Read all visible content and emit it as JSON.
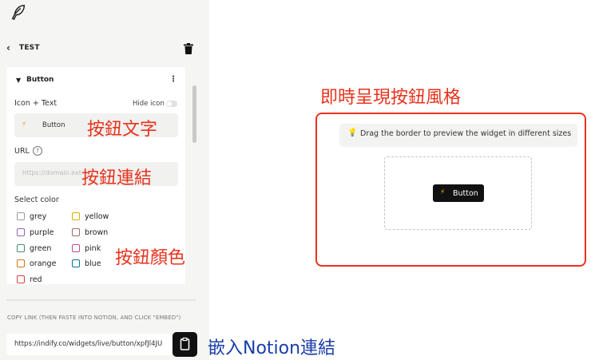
{
  "header": {
    "back_icon": "chevron-left-icon",
    "title": "TEST",
    "delete_icon": "trash-icon",
    "logo_icon": "feather-icon"
  },
  "widget": {
    "name": "Button",
    "section_icon": "caret-down-icon",
    "menu_icon": "kebab-icon",
    "icon_text_label": "Icon + Text",
    "hide_icon_label": "Hide icon",
    "hide_icon_on": false,
    "icon_glyph": "⚡",
    "text_value": "Button",
    "url_label": "URL",
    "url_help": "?",
    "url_placeholder": "https://domain.ext",
    "select_color_label": "Select color",
    "colors_left": [
      {
        "name": "grey",
        "color": "#9b9a97"
      },
      {
        "name": "purple",
        "color": "#9065b0"
      },
      {
        "name": "green",
        "color": "#4d8b72"
      },
      {
        "name": "orange",
        "color": "#d9730d"
      },
      {
        "name": "red",
        "color": "#e03e3e"
      }
    ],
    "colors_right": [
      {
        "name": "yellow",
        "color": "#dfab01"
      },
      {
        "name": "brown",
        "color": "#937264"
      },
      {
        "name": "pink",
        "color": "#c14c8a"
      },
      {
        "name": "blue",
        "color": "#0b6e99"
      }
    ]
  },
  "copy": {
    "label": "COPY LINK (THEN PASTE INTO NOTION, AND CLICK \"EMBED\")",
    "link": "https://indify.co/widgets/live/button/xpfJl4JU",
    "copy_icon": "clipboard-icon"
  },
  "preview": {
    "tip_icon": "💡",
    "tip_text": "Drag the border to preview the widget in different sizes",
    "button_glyph": "⚡",
    "button_text": "Button"
  },
  "annotations": {
    "button_text": "按鈕文字",
    "button_link": "按鈕連結",
    "button_color": "按鈕顏色",
    "live_preview": "即時呈現按鈕風格",
    "embed": "嵌入Notion連結",
    "accent_red": "#e8331d",
    "accent_blue": "#1a3ea8"
  }
}
